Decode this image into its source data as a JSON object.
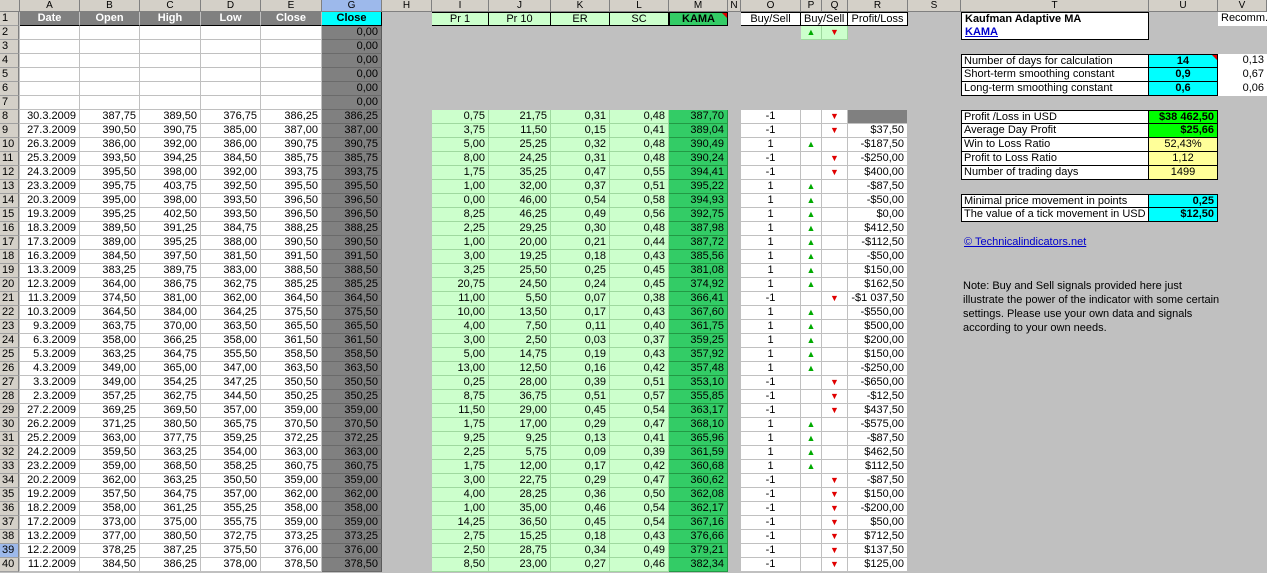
{
  "columns": [
    "A",
    "B",
    "C",
    "D",
    "E",
    "G",
    "H",
    "I",
    "J",
    "K",
    "L",
    "M",
    "N",
    "O",
    "P",
    "Q",
    "R",
    "S",
    "T",
    "U",
    "V"
  ],
  "headers": {
    "date": "Date",
    "open": "Open",
    "high": "High",
    "low": "Low",
    "close": "Close",
    "close_g": "Close",
    "pr1": "Pr 1",
    "pr10": "Pr 10",
    "er": "ER",
    "sc": "SC",
    "kama": "KAMA",
    "buysell": "Buy/Sell",
    "buysell_pq": "Buy/Sell",
    "profit": "Profit/Loss",
    "title": "Kaufman Adaptive MA",
    "title_link": "KAMA",
    "recomm": "Recomm."
  },
  "row_numbers": [
    "1",
    "2",
    "3",
    "4",
    "5",
    "6",
    "7",
    "8",
    "9",
    "10",
    "11",
    "12",
    "13",
    "14",
    "15",
    "16",
    "17",
    "18",
    "19",
    "20",
    "21",
    "22",
    "23",
    "24",
    "25",
    "26",
    "27",
    "28",
    "29",
    "30",
    "31",
    "32",
    "33",
    "34",
    "35",
    "36",
    "37",
    "38",
    "39",
    "40"
  ],
  "empty_close_values": [
    "0,00",
    "0,00",
    "0,00",
    "0,00",
    "0,00",
    "0,00"
  ],
  "signal_header": {
    "up": "▲",
    "down": "▼"
  },
  "rows": [
    [
      "30.3.2009",
      "387,75",
      "389,50",
      "376,75",
      "386,25",
      "386,25",
      "0,75",
      "21,75",
      "0,31",
      "0,48",
      "387,70",
      "-1",
      "down",
      ""
    ],
    [
      "27.3.2009",
      "390,50",
      "390,75",
      "385,00",
      "387,00",
      "387,00",
      "3,75",
      "11,50",
      "0,15",
      "0,41",
      "389,04",
      "-1",
      "down",
      "$37,50"
    ],
    [
      "26.3.2009",
      "386,00",
      "392,00",
      "386,00",
      "390,75",
      "390,75",
      "5,00",
      "25,25",
      "0,32",
      "0,48",
      "390,49",
      "1",
      "up",
      "-$187,50"
    ],
    [
      "25.3.2009",
      "393,50",
      "394,25",
      "384,50",
      "385,75",
      "385,75",
      "8,00",
      "24,25",
      "0,31",
      "0,48",
      "390,24",
      "-1",
      "down",
      "-$250,00"
    ],
    [
      "24.3.2009",
      "395,50",
      "398,00",
      "392,00",
      "393,75",
      "393,75",
      "1,75",
      "35,25",
      "0,47",
      "0,55",
      "394,41",
      "-1",
      "down",
      "$400,00"
    ],
    [
      "23.3.2009",
      "395,75",
      "403,75",
      "392,50",
      "395,50",
      "395,50",
      "1,00",
      "32,00",
      "0,37",
      "0,51",
      "395,22",
      "1",
      "up",
      "-$87,50"
    ],
    [
      "20.3.2009",
      "395,00",
      "398,00",
      "393,50",
      "396,50",
      "396,50",
      "0,00",
      "46,00",
      "0,54",
      "0,58",
      "394,93",
      "1",
      "up",
      "-$50,00"
    ],
    [
      "19.3.2009",
      "395,25",
      "402,50",
      "393,50",
      "396,50",
      "396,50",
      "8,25",
      "46,25",
      "0,49",
      "0,56",
      "392,75",
      "1",
      "up",
      "$0,00"
    ],
    [
      "18.3.2009",
      "389,50",
      "391,25",
      "384,75",
      "388,25",
      "388,25",
      "2,25",
      "29,25",
      "0,30",
      "0,48",
      "387,98",
      "1",
      "up",
      "$412,50"
    ],
    [
      "17.3.2009",
      "389,00",
      "395,25",
      "388,00",
      "390,50",
      "390,50",
      "1,00",
      "20,00",
      "0,21",
      "0,44",
      "387,72",
      "1",
      "up",
      "-$112,50"
    ],
    [
      "16.3.2009",
      "384,50",
      "397,50",
      "381,50",
      "391,50",
      "391,50",
      "3,00",
      "19,25",
      "0,18",
      "0,43",
      "385,56",
      "1",
      "up",
      "-$50,00"
    ],
    [
      "13.3.2009",
      "383,25",
      "389,75",
      "383,00",
      "388,50",
      "388,50",
      "3,25",
      "25,50",
      "0,25",
      "0,45",
      "381,08",
      "1",
      "up",
      "$150,00"
    ],
    [
      "12.3.2009",
      "364,00",
      "386,75",
      "362,75",
      "385,25",
      "385,25",
      "20,75",
      "24,50",
      "0,24",
      "0,45",
      "374,92",
      "1",
      "up",
      "$162,50"
    ],
    [
      "11.3.2009",
      "374,50",
      "381,00",
      "362,00",
      "364,50",
      "364,50",
      "11,00",
      "5,50",
      "0,07",
      "0,38",
      "366,41",
      "-1",
      "down",
      "-$1 037,50"
    ],
    [
      "10.3.2009",
      "364,50",
      "384,00",
      "364,25",
      "375,50",
      "375,50",
      "10,00",
      "13,50",
      "0,17",
      "0,43",
      "367,60",
      "1",
      "up",
      "-$550,00"
    ],
    [
      "9.3.2009",
      "363,75",
      "370,00",
      "363,50",
      "365,50",
      "365,50",
      "4,00",
      "7,50",
      "0,11",
      "0,40",
      "361,75",
      "1",
      "up",
      "$500,00"
    ],
    [
      "6.3.2009",
      "358,00",
      "366,25",
      "358,00",
      "361,50",
      "361,50",
      "3,00",
      "2,50",
      "0,03",
      "0,37",
      "359,25",
      "1",
      "up",
      "$200,00"
    ],
    [
      "5.3.2009",
      "363,25",
      "364,75",
      "355,50",
      "358,50",
      "358,50",
      "5,00",
      "14,75",
      "0,19",
      "0,43",
      "357,92",
      "1",
      "up",
      "$150,00"
    ],
    [
      "4.3.2009",
      "349,00",
      "365,00",
      "347,00",
      "363,50",
      "363,50",
      "13,00",
      "12,50",
      "0,16",
      "0,42",
      "357,48",
      "1",
      "up",
      "-$250,00"
    ],
    [
      "3.3.2009",
      "349,00",
      "354,25",
      "347,25",
      "350,50",
      "350,50",
      "0,25",
      "28,00",
      "0,39",
      "0,51",
      "353,10",
      "-1",
      "down",
      "-$650,00"
    ],
    [
      "2.3.2009",
      "357,25",
      "362,75",
      "344,50",
      "350,25",
      "350,25",
      "8,75",
      "36,75",
      "0,51",
      "0,57",
      "355,85",
      "-1",
      "down",
      "-$12,50"
    ],
    [
      "27.2.2009",
      "369,25",
      "369,50",
      "357,00",
      "359,00",
      "359,00",
      "11,50",
      "29,00",
      "0,45",
      "0,54",
      "363,17",
      "-1",
      "down",
      "$437,50"
    ],
    [
      "26.2.2009",
      "371,25",
      "380,50",
      "365,75",
      "370,50",
      "370,50",
      "1,75",
      "17,00",
      "0,29",
      "0,47",
      "368,10",
      "1",
      "up",
      "-$575,00"
    ],
    [
      "25.2.2009",
      "363,00",
      "377,75",
      "359,25",
      "372,25",
      "372,25",
      "9,25",
      "9,25",
      "0,13",
      "0,41",
      "365,96",
      "1",
      "up",
      "-$87,50"
    ],
    [
      "24.2.2009",
      "359,50",
      "363,25",
      "354,00",
      "363,00",
      "363,00",
      "2,25",
      "5,75",
      "0,09",
      "0,39",
      "361,59",
      "1",
      "up",
      "$462,50"
    ],
    [
      "23.2.2009",
      "359,00",
      "368,50",
      "358,25",
      "360,75",
      "360,75",
      "1,75",
      "12,00",
      "0,17",
      "0,42",
      "360,68",
      "1",
      "up",
      "$112,50"
    ],
    [
      "20.2.2009",
      "362,00",
      "363,25",
      "350,50",
      "359,00",
      "359,00",
      "3,00",
      "22,75",
      "0,29",
      "0,47",
      "360,62",
      "-1",
      "down",
      "-$87,50"
    ],
    [
      "19.2.2009",
      "357,50",
      "364,75",
      "357,00",
      "362,00",
      "362,00",
      "4,00",
      "28,25",
      "0,36",
      "0,50",
      "362,08",
      "-1",
      "down",
      "$150,00"
    ],
    [
      "18.2.2009",
      "358,00",
      "361,25",
      "355,25",
      "358,00",
      "358,00",
      "1,00",
      "35,00",
      "0,46",
      "0,54",
      "362,17",
      "-1",
      "down",
      "-$200,00"
    ],
    [
      "17.2.2009",
      "373,00",
      "375,00",
      "355,75",
      "359,00",
      "359,00",
      "14,25",
      "36,50",
      "0,45",
      "0,54",
      "367,16",
      "-1",
      "down",
      "$50,00"
    ],
    [
      "13.2.2009",
      "377,00",
      "380,50",
      "372,75",
      "373,25",
      "373,25",
      "2,75",
      "15,25",
      "0,18",
      "0,43",
      "376,66",
      "-1",
      "down",
      "$712,50"
    ],
    [
      "12.2.2009",
      "378,25",
      "387,25",
      "375,50",
      "376,00",
      "376,00",
      "2,50",
      "28,75",
      "0,34",
      "0,49",
      "379,21",
      "-1",
      "down",
      "$137,50"
    ],
    [
      "11.2.2009",
      "384,50",
      "386,25",
      "378,00",
      "378,50",
      "378,50",
      "8,50",
      "23,00",
      "0,27",
      "0,46",
      "382,34",
      "-1",
      "down",
      "$125,00"
    ]
  ],
  "params": [
    {
      "label": "Number of days for calculation",
      "value": "14",
      "recomm": "0,13"
    },
    {
      "label": "Short-term smoothing constant",
      "value": "0,9",
      "recomm": "0,67"
    },
    {
      "label": "Long-term smoothing constant",
      "value": "0,6",
      "recomm": "0,06"
    }
  ],
  "stats": [
    {
      "label": "Profit /Loss in USD",
      "value": "$38 462,50",
      "style": "green"
    },
    {
      "label": "Average Day Profit",
      "value": "$25,66",
      "style": "green"
    },
    {
      "label": "Win to Loss Ratio",
      "value": "52,43%",
      "style": "yellow"
    },
    {
      "label": "Profit to Loss Ratio",
      "value": "1,12",
      "style": "yellow"
    },
    {
      "label": "Number of trading days",
      "value": "1499",
      "style": "yellow"
    }
  ],
  "ticks": [
    {
      "label": "Minimal price movement in points",
      "value": "0,25"
    },
    {
      "label": "The value of a tick movement in USD",
      "value": "$12,50"
    }
  ],
  "site_link": "© Technicalindicators.net",
  "note": "Note: Buy and Sell signals provided here just illustrate the power of the indicator with some certain settings. Please use your own data and signals according to your own needs.",
  "colors": {
    "sheet_bg": "#c0c0c0",
    "kama_green": "#33cc66",
    "light_green": "#ccffcc",
    "cyan": "#00ffff",
    "bright_green": "#00ff00",
    "yellow": "#ffff99",
    "up": "#00aa00",
    "down": "#e00000"
  }
}
